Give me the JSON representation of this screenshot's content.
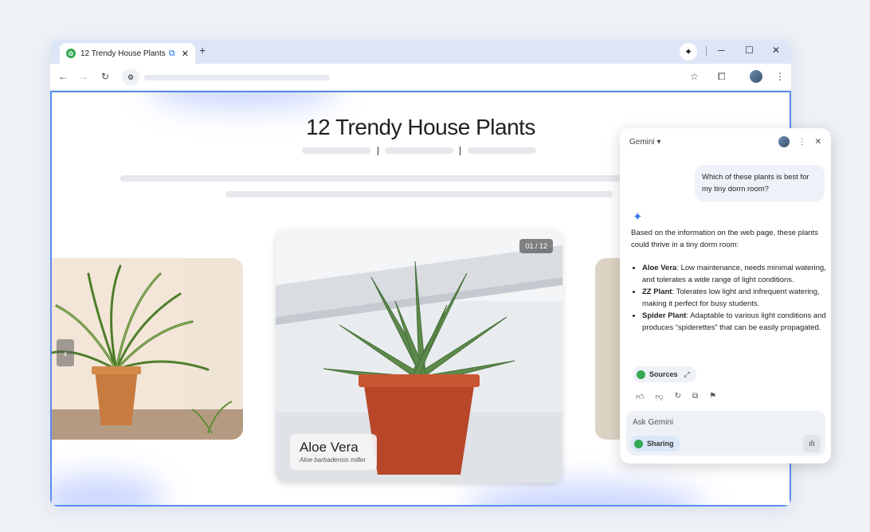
{
  "browser": {
    "tab_title": "12 Trendy House Plants",
    "tab_favicon": "plant-favicon",
    "new_tab": "+",
    "close_tab": "✕",
    "window_controls": {
      "minimize": "─",
      "maximize": "☐",
      "close": "✕"
    },
    "nav": {
      "back": "←",
      "forward": "→",
      "reload": "↻"
    }
  },
  "page": {
    "title": "12 Trendy House Plants",
    "carousel": {
      "counter": "01 / 12",
      "current": {
        "name": "Aloe Vera",
        "latin": "Aloe barbadensis miller"
      }
    }
  },
  "gemini_panel": {
    "title": "Gemini",
    "user_message": "Which of these plants is best for my tiny dorm room?",
    "intro": "Based on the information on the web page, these plants could thrive in a tiny dorm room:",
    "items": [
      {
        "name": "Aloe Vera",
        "text": ": Low maintenance, needs minimal watering, and tolerates a wide range of light conditions."
      },
      {
        "name": "ZZ Plant",
        "text": ": Tolerates low light and infrequent watering, making it perfect for busy students."
      },
      {
        "name": "Spider Plant",
        "text": ": Adaptable to various light conditions and produces “spiderettes” that can be easily propagated."
      }
    ],
    "sources_label": "Sources",
    "input_placeholder": "Ask Gemini",
    "sharing_label": "Sharing"
  },
  "colors": {
    "accent": "#1a73e8",
    "border": "#5b8cf0",
    "tabstrip": "#dde6f7"
  }
}
